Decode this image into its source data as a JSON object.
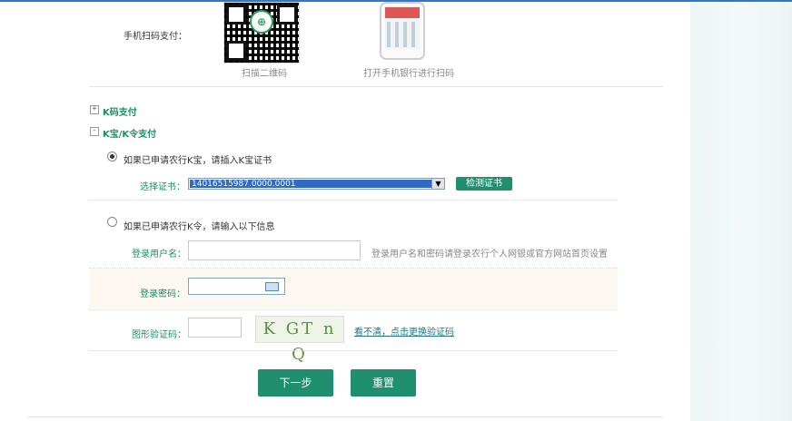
{
  "mobile_pay": {
    "label": "手机扫码支付：",
    "qr_caption": "扫描二维码",
    "phone_caption": "打开手机银行进行扫码"
  },
  "sections": {
    "kcode": {
      "expander": "+",
      "label": "K码支付"
    },
    "kbao": {
      "expander": "-",
      "label": "K宝/K令支付"
    }
  },
  "kbao_option": {
    "label": "如果已申请农行K宝，请插入K宝证书",
    "cert_label": "选择证书：",
    "cert_value": "14016515987.0000.0001",
    "detect_button": "检测证书"
  },
  "kling_option": {
    "label": "如果已申请农行K令，请输入以下信息",
    "username_label": "登录用户名：",
    "username_value": "",
    "username_hint": "登录用户名和密码请登录农行个人网银或官方网站首页设置",
    "password_label": "登录密码：",
    "captcha_label": "图形验证码：",
    "captcha_value": "",
    "captcha_image_text": "K GT n Q",
    "refresh_link": "看不清，点击更换验证码"
  },
  "actions": {
    "next": "下一步",
    "reset": "重置"
  },
  "colors": {
    "accent": "#1f8f6e",
    "label_green": "#1c8f66",
    "selected_option": "#316ac5"
  },
  "icons": {
    "qr": "qr-code-icon",
    "phone": "phone-app-icon",
    "keyboard": "soft-keyboard-icon"
  }
}
